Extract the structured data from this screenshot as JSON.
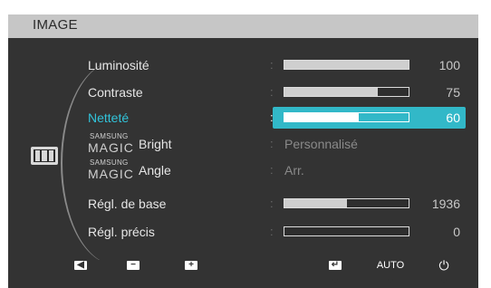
{
  "menu": {
    "title": "IMAGE",
    "icon": "picture-icon"
  },
  "rows": [
    {
      "label": "Luminosité",
      "value": "100",
      "fraction": 1.0
    },
    {
      "label": "Contraste",
      "value": "75",
      "fraction": 0.75
    },
    {
      "label": "Netteté",
      "value": "60",
      "fraction": 0.6,
      "selected": true
    },
    {
      "brand": "SAMSUNG",
      "magic": "MAGIC",
      "suffix": "Bright",
      "value": "Personnalisé"
    },
    {
      "brand": "SAMSUNG",
      "magic": "MAGIC",
      "suffix": "Angle",
      "value": "Arr."
    },
    {
      "label": "Régl. de base",
      "value": "1936",
      "fraction": 0.5
    },
    {
      "label": "Régl. précis",
      "value": "0",
      "fraction": 0.0
    }
  ],
  "separator": ":",
  "buttons": [
    {
      "name": "left-arrow-icon",
      "glyph": "◀"
    },
    {
      "name": "minus-icon",
      "glyph": "−"
    },
    {
      "name": "plus-icon",
      "glyph": "+"
    },
    {
      "name": "enter-icon",
      "glyph": "↵"
    },
    {
      "name": "auto-button",
      "label": "AUTO"
    },
    {
      "name": "power-icon",
      "glyph": "⏻"
    }
  ],
  "colors": {
    "accent": "#32b8c8",
    "background": "#333333",
    "titlebar": "#c6c6c6"
  }
}
